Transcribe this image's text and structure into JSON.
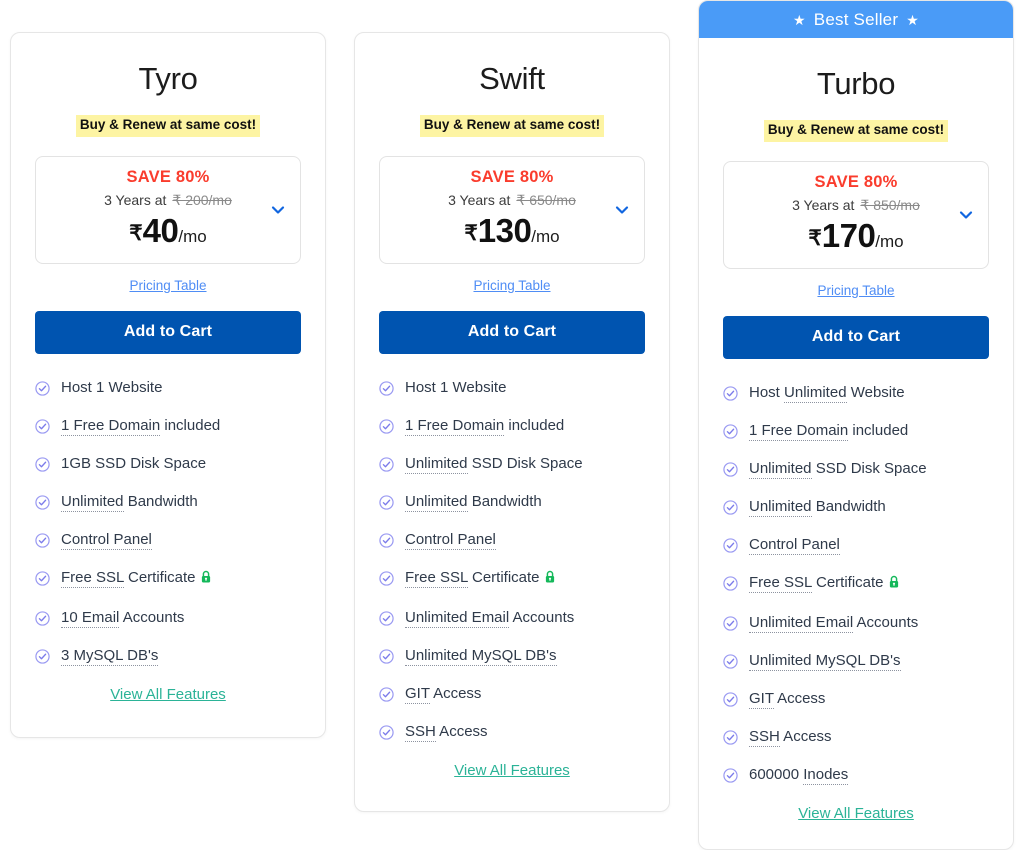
{
  "page": {
    "currency_symbol": "₹",
    "colors": {
      "best_seller_banner": "#4a9bf7",
      "cta_button": "#0054b0",
      "save_text": "#fa3c2d",
      "renew_highlight": "#fdf4a3",
      "pricing_table_link": "#4f8df5",
      "view_all_link": "#2bb397",
      "check_icon": "#8b8bf0",
      "lock_icon": "#14b85a",
      "chevron": "#1166e0"
    }
  },
  "common": {
    "renew_badge": "Buy & Renew at same cost!",
    "save_label": "SAVE 80%",
    "term_label": "3 Years at",
    "per_month": "/mo",
    "pricing_table_link": "Pricing Table",
    "add_to_cart": "Add to Cart",
    "view_all_features": "View All Features",
    "chevron_icon": "chevron-down-icon",
    "check_icon": "check-circle-icon",
    "lock_icon": "padlock-icon",
    "star_icon": "★"
  },
  "plans": [
    {
      "id": "tyro",
      "name": "Tyro",
      "badge": null,
      "renew_badge": "Buy & Renew at same cost!",
      "save_label": "SAVE 80%",
      "term_label": "3 Years at",
      "original_price": "₹ 200/mo",
      "price_currency": "₹",
      "price_amount": "40",
      "price_suffix": "/mo",
      "pricing_table_link": "Pricing Table",
      "add_to_cart": "Add to Cart",
      "view_all_features": "View All Features",
      "features": [
        {
          "text": "Host 1 Website",
          "dotted": "",
          "lock": false
        },
        {
          "text": "1 Free Domain included",
          "dotted": "1 Free Domain",
          "lock": false
        },
        {
          "text": "1GB SSD Disk Space",
          "dotted": "",
          "lock": false
        },
        {
          "text": "Unlimited Bandwidth",
          "dotted": "Unlimited",
          "lock": false
        },
        {
          "text": "Control Panel",
          "dotted": "Control Panel",
          "lock": false
        },
        {
          "text": "Free SSL Certificate",
          "dotted": "Free SSL",
          "lock": true
        },
        {
          "text": "10 Email Accounts",
          "dotted": "10 Email",
          "lock": false
        },
        {
          "text": "3 MySQL DB's",
          "dotted": "3 MySQL DB's",
          "lock": false
        }
      ]
    },
    {
      "id": "swift",
      "name": "Swift",
      "badge": null,
      "renew_badge": "Buy & Renew at same cost!",
      "save_label": "SAVE 80%",
      "term_label": "3 Years at",
      "original_price": "₹ 650/mo",
      "price_currency": "₹",
      "price_amount": "130",
      "price_suffix": "/mo",
      "pricing_table_link": "Pricing Table",
      "add_to_cart": "Add to Cart",
      "view_all_features": "View All Features",
      "features": [
        {
          "text": "Host 1 Website",
          "dotted": "",
          "lock": false
        },
        {
          "text": "1 Free Domain included",
          "dotted": "1 Free Domain",
          "lock": false
        },
        {
          "text": "Unlimited SSD Disk Space",
          "dotted": "Unlimited",
          "lock": false
        },
        {
          "text": "Unlimited Bandwidth",
          "dotted": "Unlimited",
          "lock": false
        },
        {
          "text": "Control Panel",
          "dotted": "Control Panel",
          "lock": false
        },
        {
          "text": "Free SSL Certificate",
          "dotted": "Free SSL",
          "lock": true
        },
        {
          "text": "Unlimited Email Accounts",
          "dotted": "Unlimited Email",
          "lock": false
        },
        {
          "text": "Unlimited MySQL DB's",
          "dotted": "Unlimited MySQL DB's",
          "lock": false
        },
        {
          "text": "GIT Access",
          "dotted": "GIT",
          "lock": false
        },
        {
          "text": "SSH Access",
          "dotted": "SSH",
          "lock": false
        }
      ]
    },
    {
      "id": "turbo",
      "name": "Turbo",
      "badge": "★ Best Seller ★",
      "badge_label": "Best Seller",
      "renew_badge": "Buy & Renew at same cost!",
      "save_label": "SAVE 80%",
      "term_label": "3 Years at",
      "original_price": "₹ 850/mo",
      "price_currency": "₹",
      "price_amount": "170",
      "price_suffix": "/mo",
      "pricing_table_link": "Pricing Table",
      "add_to_cart": "Add to Cart",
      "view_all_features": "View All Features",
      "features": [
        {
          "text": "Host Unlimited Website",
          "dotted": "Unlimited",
          "lock": false
        },
        {
          "text": "1 Free Domain included",
          "dotted": "1 Free Domain",
          "lock": false
        },
        {
          "text": "Unlimited SSD Disk Space",
          "dotted": "Unlimited",
          "lock": false
        },
        {
          "text": "Unlimited Bandwidth",
          "dotted": "Unlimited",
          "lock": false
        },
        {
          "text": "Control Panel",
          "dotted": "Control Panel",
          "lock": false
        },
        {
          "text": "Free SSL Certificate",
          "dotted": "Free SSL",
          "lock": true
        },
        {
          "text": "Unlimited Email Accounts",
          "dotted": "Unlimited Email",
          "lock": false
        },
        {
          "text": "Unlimited MySQL DB's",
          "dotted": "Unlimited MySQL DB's",
          "lock": false
        },
        {
          "text": "GIT Access",
          "dotted": "GIT",
          "lock": false
        },
        {
          "text": "SSH Access",
          "dotted": "SSH",
          "lock": false
        },
        {
          "text": "600000 Inodes",
          "dotted": "Inodes",
          "lock": false
        }
      ]
    }
  ]
}
